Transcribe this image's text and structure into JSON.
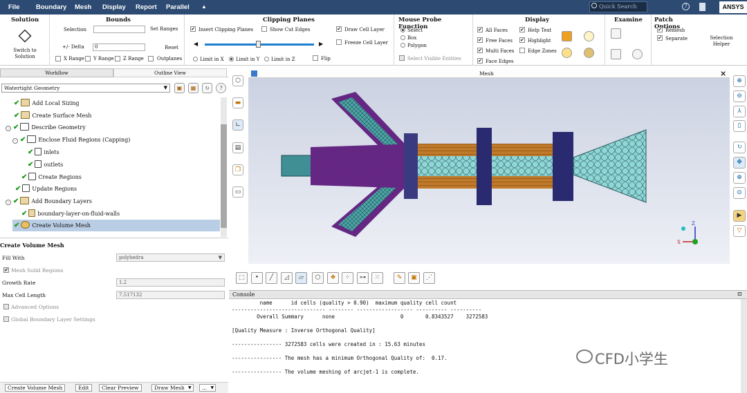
{
  "menu": [
    "File",
    "Boundary",
    "Mesh",
    "Display",
    "Report",
    "Parallel"
  ],
  "menu_expand": "▲",
  "search_placeholder": "Quick Search",
  "brand": "ANSYS",
  "ribbon": {
    "solution": {
      "title": "Solution",
      "button": "Switch to Solution"
    },
    "bounds": {
      "title": "Bounds",
      "selection": "Selection",
      "set_ranges": "Set Ranges",
      "delta_label": "+/- Delta",
      "delta_value": "0",
      "reset": "Reset",
      "x_range": "X Range",
      "y_range": "Y Range",
      "z_range": "Z Range",
      "outplanes": "Outplanes"
    },
    "clipping": {
      "title": "Clipping Planes",
      "insert": "Insert Clipping Planes",
      "show_cut": "Show Cut Edges",
      "draw_cell": "Draw Cell Layer",
      "freeze": "Freeze Cell Layer",
      "limit_x": "Limit in X",
      "limit_y": "Limit in Y",
      "limit_z": "Limit in Z",
      "flip": "Flip"
    },
    "probe": {
      "title": "Mouse Probe Function",
      "select": "Select",
      "box": "Box",
      "polygon": "Polygon",
      "visible": "Select Visible Entities"
    },
    "display": {
      "title": "Display",
      "all_faces": "All Faces",
      "free_faces": "Free Faces",
      "multi_faces": "Multi Faces",
      "face_edges": "Face Edges",
      "help_text": "Help Text",
      "highlight": "Highlight",
      "edge_zones": "Edge Zones"
    },
    "examine": {
      "title": "Examine"
    },
    "patch": {
      "title": "Patch Options",
      "remesh": "Remesh",
      "separate": "Separate"
    },
    "selection_helper": "Selection Helper"
  },
  "left": {
    "tabs": [
      "Workflow",
      "Outline View"
    ],
    "workflow_type": "Watertight Geometry",
    "tree": [
      {
        "label": "Add Local Sizing"
      },
      {
        "label": "Create Surface Mesh"
      },
      {
        "label": "Describe Geometry"
      },
      {
        "label": "Enclose Fluid Regions (Capping)"
      },
      {
        "label": "inlets"
      },
      {
        "label": "outlets"
      },
      {
        "label": "Create Regions"
      },
      {
        "label": "Update Regions"
      },
      {
        "label": "Add Boundary Layers"
      },
      {
        "label": "boundary-layer-on-fluid-walls"
      },
      {
        "label": "Create Volume Mesh"
      }
    ],
    "properties": {
      "title": "Create Volume Mesh",
      "fill_with_label": "Fill With",
      "fill_with_value": "polyhedra",
      "mesh_solid": "Mesh Solid Regions",
      "growth_rate_label": "Growth Rate",
      "growth_rate_value": "1.2",
      "max_cell_label": "Max Cell Length",
      "max_cell_value": "7.517132",
      "advanced": "Advanced Options",
      "global_bl": "Global Boundary Layer Settings"
    },
    "buttons": [
      "Create Volume Mesh",
      "Edit",
      "Clear Preview",
      "Draw Mesh",
      "..."
    ]
  },
  "viewport": {
    "title": "Mesh"
  },
  "console": {
    "title": "Console",
    "lines": [
      "         name      id cells (quality > 0.90)  maximum quality cell count",
      "------------------------------ -------- ------------------ ---------- ----------",
      "        Overall Summary      none                     0       0.8343527    3272583",
      "",
      "[Quality Measure : Inverse Orthogonal Quality]",
      "",
      "---------------- 3272583 cells were created in : 15.63 minutes",
      "",
      "---------------- The mesh has a minimum Orthogonal Quality of:  0.17.",
      "",
      "---------------- The volume meshing of arcjet-1 is complete."
    ]
  },
  "watermark": "CFD小学生",
  "colors": {
    "menubar": "#2c4a72",
    "mesh_teal": "#4fa8a8",
    "mesh_purple": "#6a2a8a",
    "mesh_orange": "#c07a2a",
    "check_green": "#1a9a1a"
  }
}
